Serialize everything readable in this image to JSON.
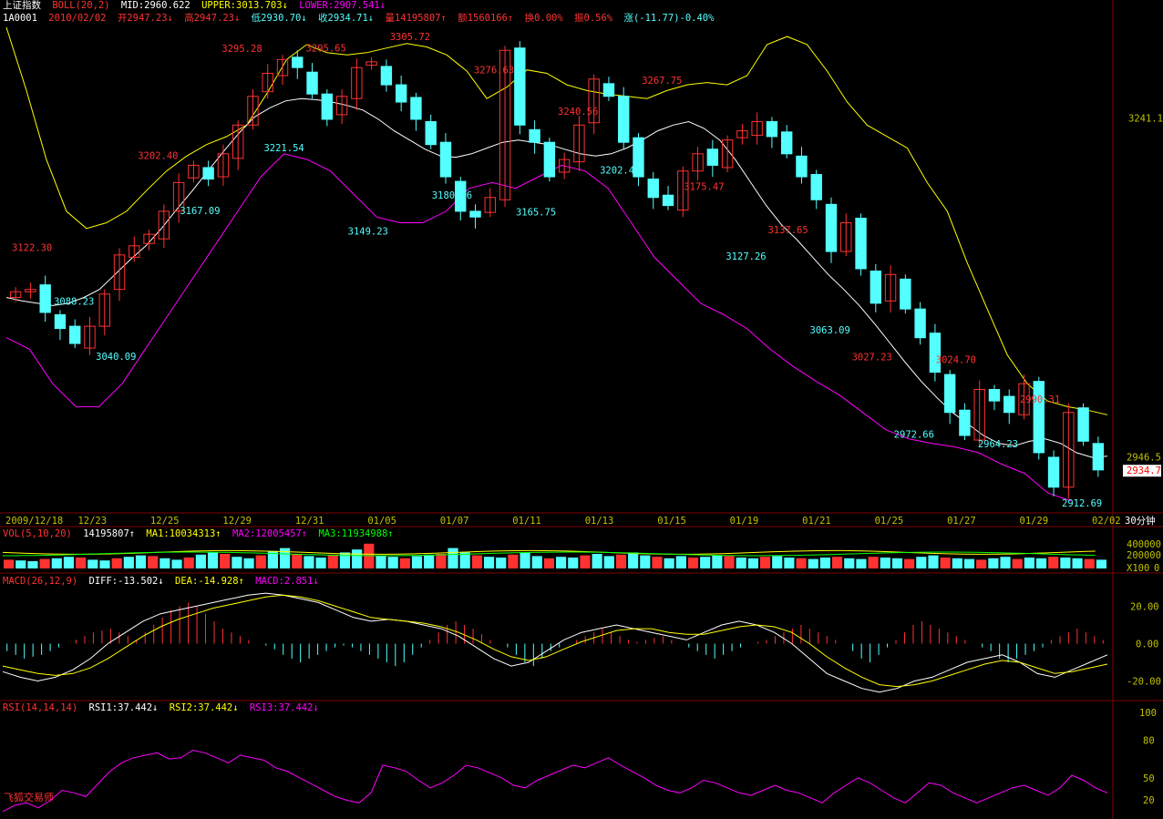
{
  "header": {
    "line1": {
      "title": "上证指数",
      "indicator": "BOLL(20,2)",
      "mid": "MID:2960.622",
      "upper": "UPPER:3013.703↓",
      "lower": "LOWER:2907.541↓"
    },
    "line2": {
      "code": "1A0001",
      "date": "2010/02/02",
      "open": "开2947.23↓",
      "high": "高2947.23↓",
      "low": "低2930.70↓",
      "close": "收2934.71↓",
      "volume": "量14195807↑",
      "amount": "额1560166↑",
      "turnover": "换0.00%",
      "amplitude": "振0.56%",
      "change": "涨(-11.77)-0.40%"
    }
  },
  "vol_header": {
    "name": "VOL(5,10,20)",
    "value": "14195807↑",
    "ma1": "MA1:10034313↑",
    "ma2": "MA2:12005457↑",
    "ma3": "MA3:11934988↑"
  },
  "macd_header": {
    "name": "MACD(26,12,9)",
    "diff": "DIFF:-13.502↓",
    "dea": "DEA:-14.928↑",
    "macd": "MACD:2.851↓"
  },
  "rsi_header": {
    "name": "RSI(14,14,14)",
    "rsi1": "RSI1:37.442↓",
    "rsi2": "RSI2:37.442↓",
    "rsi3": "RSI3:37.442↓"
  },
  "period_label": "30分钟",
  "watermark": "飞狐交易师",
  "colors": {
    "up": "#ff3232",
    "down": "#54ffff",
    "mid_line": "#ffffff",
    "upper_line": "#ffff00",
    "lower_line": "#ff00ff",
    "axis_text": "#c0c000",
    "last_price_bg": "#ffffff",
    "last_price_fg": "#ff0000"
  },
  "chart_data": [
    {
      "type": "candlestick",
      "title": "上证指数 BOLL(20,2)",
      "x_tick_labels": [
        "2009/12/18",
        "12/23",
        "12/25",
        "12/29",
        "12/31",
        "01/05",
        "01/07",
        "01/11",
        "01/13",
        "01/15",
        "01/19",
        "01/21",
        "01/25",
        "01/27",
        "01/29",
        "02/02"
      ],
      "y_tick_labels": [
        "3241.1",
        "2946.5"
      ],
      "last_price": "2934.7",
      "y_range": [
        2900,
        3320
      ],
      "annotations": [
        {
          "text": "3122.30",
          "value": 3122.3,
          "kind": "high"
        },
        {
          "text": "3088.23",
          "value": 3088.23,
          "kind": "low"
        },
        {
          "text": "3040.09",
          "value": 3040.09,
          "kind": "low"
        },
        {
          "text": "3202.40",
          "value": 3202.4,
          "kind": "high"
        },
        {
          "text": "3167.09",
          "value": 3167.09,
          "kind": "low"
        },
        {
          "text": "3295.28",
          "value": 3295.28,
          "kind": "high"
        },
        {
          "text": "3221.54",
          "value": 3221.54,
          "kind": "low"
        },
        {
          "text": "3295.65",
          "value": 3295.65,
          "kind": "high"
        },
        {
          "text": "3149.23",
          "value": 3149.23,
          "kind": "low"
        },
        {
          "text": "3305.72",
          "value": 3305.72,
          "kind": "high"
        },
        {
          "text": "3180.46",
          "value": 3180.46,
          "kind": "low"
        },
        {
          "text": "3276.63",
          "value": 3276.63,
          "kind": "high"
        },
        {
          "text": "3165.75",
          "value": 3165.75,
          "kind": "low"
        },
        {
          "text": "3240.56",
          "value": 3240.56,
          "kind": "high"
        },
        {
          "text": "3202.49",
          "value": 3202.49,
          "kind": "low"
        },
        {
          "text": "3267.75",
          "value": 3267.75,
          "kind": "high"
        },
        {
          "text": "3175.47",
          "value": 3175.47,
          "kind": "high"
        },
        {
          "text": "3127.26",
          "value": 3127.26,
          "kind": "low"
        },
        {
          "text": "3137.65",
          "value": 3137.65,
          "kind": "high"
        },
        {
          "text": "3063.09",
          "value": 3063.09,
          "kind": "low"
        },
        {
          "text": "3027.23",
          "value": 3027.23,
          "kind": "high"
        },
        {
          "text": "2972.66",
          "value": 2972.66,
          "kind": "low"
        },
        {
          "text": "3024.70",
          "value": 3024.7,
          "kind": "high"
        },
        {
          "text": "2964.23",
          "value": 2964.23,
          "kind": "low"
        },
        {
          "text": "2990.31",
          "value": 2990.31,
          "kind": "high"
        },
        {
          "text": "2912.69",
          "value": 2912.69,
          "kind": "low"
        }
      ],
      "series": [
        {
          "name": "MID",
          "values": [
            3085,
            3082,
            3080,
            3078,
            3080,
            3085,
            3092,
            3105,
            3118,
            3130,
            3145,
            3162,
            3178,
            3195,
            3212,
            3228,
            3242,
            3250,
            3256,
            3258,
            3257,
            3255,
            3252,
            3248,
            3240,
            3230,
            3222,
            3214,
            3208,
            3207,
            3210,
            3215,
            3220,
            3222,
            3220,
            3218,
            3214,
            3210,
            3208,
            3210,
            3215,
            3222,
            3230,
            3235,
            3238,
            3232,
            3222,
            3205,
            3185,
            3165,
            3148,
            3135,
            3120,
            3105,
            3092,
            3078,
            3062,
            3045,
            3028,
            3012,
            2998,
            2985,
            2975,
            2965,
            2958,
            2956,
            2960,
            2962,
            2958,
            2950,
            2946,
            2947
          ]
        },
        {
          "name": "UPPER",
          "values": [
            3320,
            3265,
            3205,
            3160,
            3145,
            3150,
            3160,
            3178,
            3195,
            3208,
            3218,
            3225,
            3235,
            3262,
            3292,
            3305,
            3298,
            3296,
            3298,
            3302,
            3306,
            3303,
            3296,
            3282,
            3258,
            3268,
            3283,
            3280,
            3270,
            3265,
            3262,
            3260,
            3258,
            3265,
            3270,
            3272,
            3270,
            3278,
            3305,
            3312,
            3305,
            3282,
            3255,
            3235,
            3225,
            3215,
            3185,
            3160,
            3115,
            3075,
            3035,
            3010,
            2995,
            2990,
            2987,
            2983
          ]
        },
        {
          "name": "LOWER",
          "values": [
            3050,
            3040,
            3010,
            2990,
            2990,
            3010,
            3040,
            3070,
            3100,
            3130,
            3160,
            3190,
            3210,
            3205,
            3195,
            3175,
            3155,
            3150,
            3150,
            3160,
            3180,
            3185,
            3180,
            3190,
            3200,
            3195,
            3180,
            3150,
            3120,
            3100,
            3080,
            3070,
            3058,
            3040,
            3025,
            3012,
            3000,
            2985,
            2970,
            2962,
            2958,
            2955,
            2950,
            2940,
            2932,
            2915,
            2908
          ]
        },
        {
          "name": "close",
          "values": [
            3090,
            3092,
            3072,
            3058,
            3045,
            3060,
            3088,
            3122,
            3130,
            3140,
            3160,
            3185,
            3200,
            3188,
            3210,
            3235,
            3260,
            3280,
            3292,
            3285,
            3262,
            3240,
            3260,
            3285,
            3290,
            3270,
            3255,
            3240,
            3218,
            3190,
            3160,
            3155,
            3172,
            3300,
            3235,
            3220,
            3190,
            3205,
            3235,
            3275,
            3260,
            3220,
            3190,
            3172,
            3165,
            3195,
            3210,
            3200,
            3222,
            3230,
            3238,
            3225,
            3210,
            3190,
            3170,
            3125,
            3150,
            3110,
            3080,
            3105,
            3075,
            3050,
            3020,
            2985,
            2965,
            3005,
            2995,
            2985,
            3010,
            2950,
            2920,
            2985,
            2960,
            2935
          ]
        }
      ]
    },
    {
      "type": "bar",
      "title": "VOL(5,10,20)",
      "y_tick_labels": [
        "400000",
        "200000",
        "X100"
      ],
      "y_range": [
        0,
        400000
      ],
      "series": [
        {
          "name": "VOL",
          "values": [
            60,
            55,
            50,
            65,
            70,
            80,
            75,
            60,
            55,
            70,
            80,
            90,
            85,
            70,
            60,
            75,
            95,
            110,
            100,
            80,
            70,
            90,
            120,
            140,
            100,
            85,
            75,
            95,
            110,
            130,
            170,
            90,
            80,
            70,
            85,
            95,
            100,
            140,
            110,
            90,
            80,
            75,
            95,
            110,
            85,
            70,
            80,
            75,
            90,
            100,
            85,
            95,
            110,
            90,
            80,
            70,
            85,
            75,
            80,
            90,
            85,
            75,
            70,
            80,
            85,
            75,
            70,
            65,
            75,
            80,
            70,
            65,
            80,
            75,
            70,
            65,
            80,
            90,
            75,
            70,
            65,
            60,
            70,
            80,
            65,
            75,
            70,
            80,
            75,
            70,
            65,
            60
          ]
        }
      ]
    },
    {
      "type": "bar",
      "title": "MACD(26,12,9)",
      "y_tick_labels": [
        "20.00",
        "0.00",
        "-20.00"
      ],
      "y_range": [
        -30,
        30
      ],
      "series": [
        {
          "name": "MACD",
          "values": [
            -4,
            -6,
            -8,
            -7,
            -6,
            -4,
            -2,
            0,
            2,
            4,
            6,
            7,
            8,
            6,
            4,
            2,
            6,
            10,
            14,
            18,
            20,
            22,
            20,
            16,
            12,
            8,
            6,
            4,
            2,
            0,
            -1,
            -3,
            -6,
            -8,
            -10,
            -8,
            -6,
            -4,
            -2,
            -1,
            -2,
            -4,
            -6,
            -8,
            -10,
            -12,
            -10,
            -6,
            -2,
            2,
            6,
            10,
            12,
            10,
            8,
            5,
            2,
            0,
            -2,
            -6,
            -10,
            -12,
            -8,
            -4,
            -2,
            0,
            2,
            4,
            6,
            8,
            6,
            4,
            2,
            1,
            2,
            3,
            4,
            2,
            0,
            -2,
            -4,
            -6,
            -8,
            -6,
            -4,
            -2,
            0,
            1,
            2,
            4,
            6,
            8,
            10,
            8,
            6,
            4,
            2,
            0,
            -4,
            -8,
            -10,
            -6,
            -2,
            2,
            6,
            10,
            12,
            10,
            8,
            6,
            4,
            2,
            0,
            -2,
            -4,
            -8,
            -10,
            -8,
            -6,
            -4,
            -2,
            2,
            4,
            6,
            8,
            6,
            4,
            2
          ]
        },
        {
          "name": "DIFF",
          "values": [
            -15,
            -18,
            -20,
            -18,
            -14,
            -8,
            0,
            6,
            12,
            16,
            18,
            20,
            22,
            24,
            26,
            27,
            26,
            24,
            22,
            18,
            14,
            12,
            13,
            12,
            10,
            8,
            4,
            -2,
            -8,
            -12,
            -10,
            -4,
            2,
            6,
            8,
            10,
            8,
            6,
            4,
            2,
            6,
            10,
            12,
            10,
            6,
            0,
            -8,
            -16,
            -20,
            -24,
            -26,
            -24,
            -20,
            -18,
            -14,
            -10,
            -8,
            -6,
            -10,
            -16,
            -18,
            -14,
            -10,
            -6
          ]
        },
        {
          "name": "DEA",
          "values": [
            -12,
            -14,
            -16,
            -17,
            -16,
            -13,
            -8,
            -2,
            4,
            9,
            13,
            16,
            19,
            21,
            23,
            25,
            26,
            25,
            23,
            20,
            17,
            14,
            13,
            12,
            11,
            9,
            6,
            2,
            -3,
            -7,
            -9,
            -7,
            -3,
            1,
            4,
            7,
            8,
            8,
            6,
            5,
            5,
            7,
            9,
            10,
            9,
            6,
            0,
            -7,
            -13,
            -18,
            -22,
            -23,
            -22,
            -20,
            -17,
            -14,
            -11,
            -9,
            -10,
            -13,
            -16,
            -15,
            -13,
            -11
          ]
        }
      ]
    },
    {
      "type": "line",
      "title": "RSI(14,14,14)",
      "y_tick_labels": [
        "100",
        "80",
        "50",
        "20"
      ],
      "y_range": [
        20,
        100
      ],
      "series": [
        {
          "name": "RSI1",
          "values": [
            23,
            28,
            30,
            26,
            32,
            40,
            38,
            35,
            45,
            55,
            62,
            66,
            68,
            70,
            65,
            66,
            72,
            70,
            66,
            62,
            68,
            66,
            64,
            58,
            55,
            50,
            45,
            40,
            35,
            32,
            30,
            38,
            60,
            58,
            55,
            48,
            42,
            46,
            52,
            60,
            58,
            54,
            50,
            44,
            42,
            48,
            52,
            56,
            60,
            58,
            62,
            66,
            60,
            55,
            50,
            44,
            40,
            38,
            42,
            48,
            46,
            42,
            38,
            36,
            40,
            44,
            40,
            38,
            34,
            30,
            38,
            44,
            50,
            46,
            40,
            34,
            30,
            38,
            46,
            44,
            38,
            34,
            30,
            34,
            38,
            42,
            44,
            40,
            36,
            42,
            52,
            48,
            42,
            38
          ]
        }
      ]
    }
  ]
}
